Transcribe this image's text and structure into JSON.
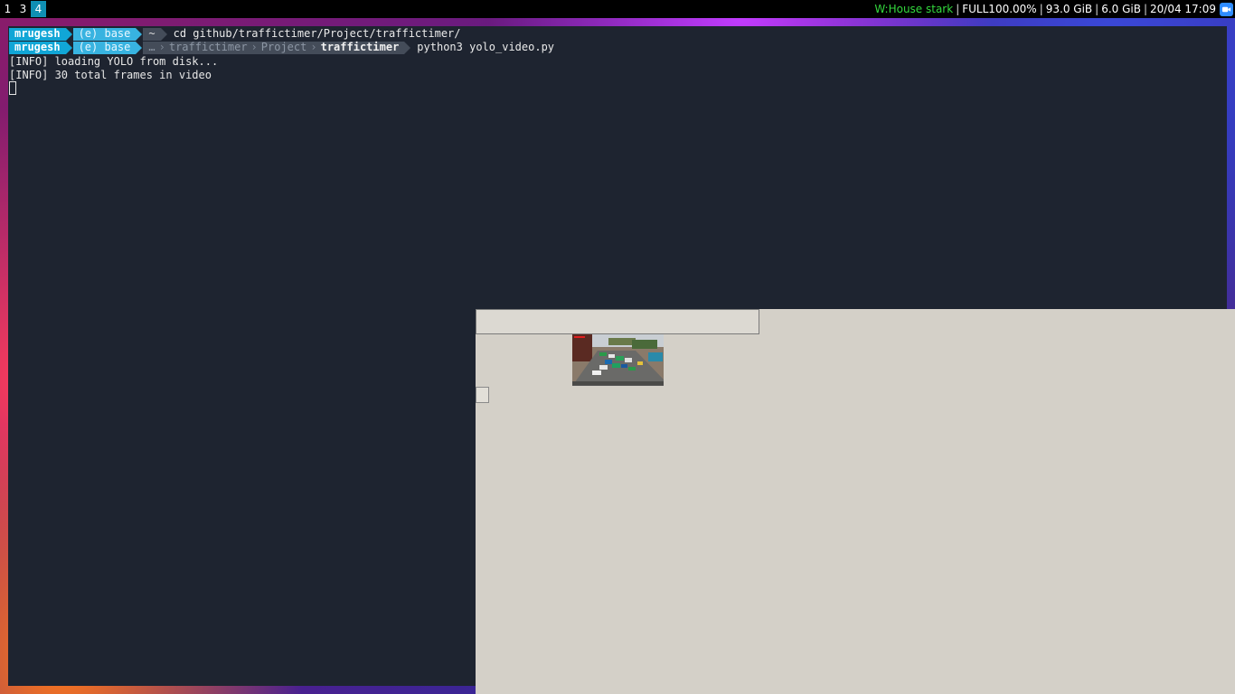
{
  "topbar": {
    "workspaces": [
      "1",
      "3",
      "4"
    ],
    "active_workspace": "4",
    "wifi": "W:House stark",
    "battery": "FULL100.00%",
    "disk": "93.0 GiB",
    "memory": "6.0 GiB",
    "datetime": "20/04 17:09",
    "separator": "|",
    "tray_icon": "zoom-icon",
    "colors": {
      "bar_bg": "#000000",
      "active_ws": "#0f8fb3",
      "wifi": "#33d83d"
    }
  },
  "terminal": {
    "prompts": [
      {
        "user": "mrugesh",
        "env": "(e) base",
        "path": [
          "~"
        ],
        "command": "cd github/traffictimer/Project/traffictimer/"
      },
      {
        "user": "mrugesh",
        "env": "(e) base",
        "path": [
          "…",
          "traffictimer",
          "Project",
          "traffictimer"
        ],
        "command": "python3 yolo_video.py"
      }
    ],
    "output": [
      "[INFO] loading YOLO from disk...",
      "[INFO] 30 total frames in video"
    ],
    "colors": {
      "bg": "#1e2430",
      "user_seg": "#11a6d6",
      "env_seg": "#38b3e0",
      "path_seg": "#444c59"
    }
  },
  "cv_window": {
    "content": "traffic-video-frame",
    "bg": "#d4d0c8"
  }
}
